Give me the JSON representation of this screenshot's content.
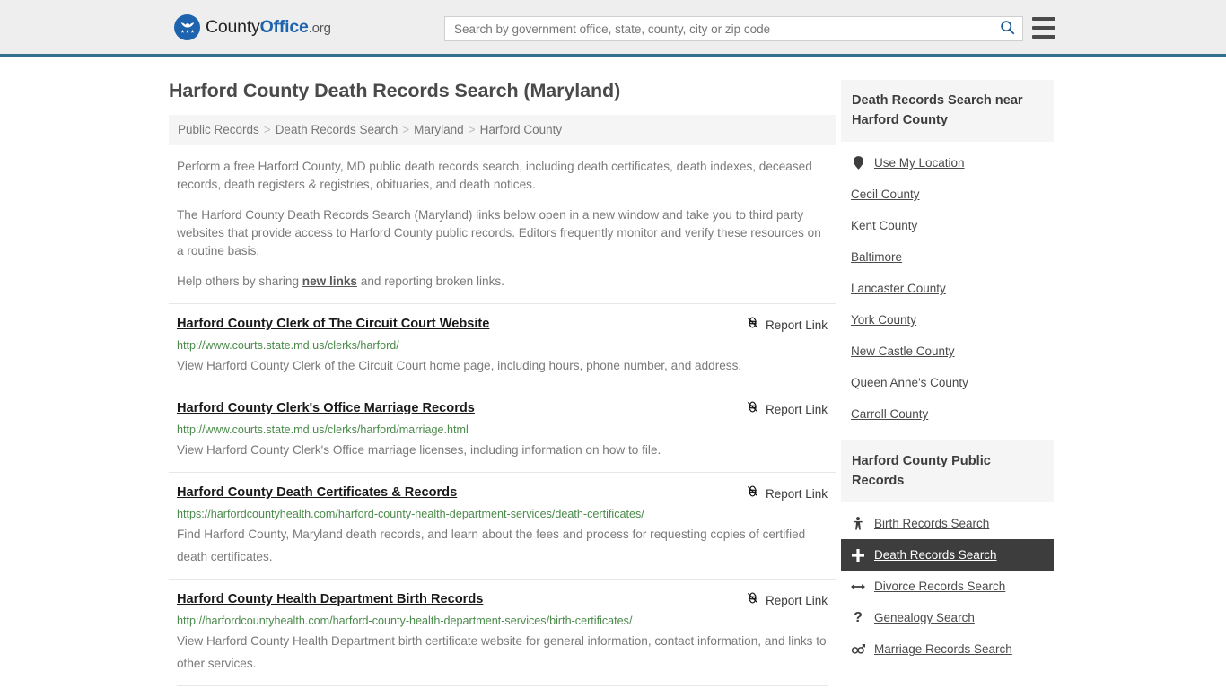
{
  "header": {
    "brand": {
      "part1": "County",
      "part2": "Office",
      "part3": ".org",
      "logo_icon": "eagle-shield-logo"
    },
    "search": {
      "value": "",
      "placeholder": "Search by government office, state, county, city or zip code",
      "icon": "search-icon"
    },
    "menu_icon": "hamburger-menu-icon"
  },
  "page": {
    "title": "Harford County Death Records Search (Maryland)",
    "breadcrumb": [
      "Public Records",
      "Death Records Search",
      "Maryland",
      "Harford County"
    ],
    "breadcrumb_separator": ">",
    "intro": [
      "Perform a free Harford County, MD public death records search, including death certificates, death indexes, deceased records, death registers & registries, obituaries, and death notices.",
      "The Harford County Death Records Search (Maryland) links below open in a new window and take you to third party websites that provide access to Harford County public records. Editors frequently monitor and verify these resources on a routine basis."
    ],
    "help_line": {
      "before": "Help others by sharing ",
      "link": "new links",
      "after": " and reporting broken links."
    }
  },
  "results": {
    "report_label": "Report Link",
    "report_icon": "broken-link-icon",
    "items": [
      {
        "title": "Harford County Clerk of The Circuit Court Website",
        "url": "http://www.courts.state.md.us/clerks/harford/",
        "description": "View Harford County Clerk of the Circuit Court home page, including hours, phone number, and address."
      },
      {
        "title": "Harford County Clerk's Office Marriage Records",
        "url": "http://www.courts.state.md.us/clerks/harford/marriage.html",
        "description": "View Harford County Clerk's Office marriage licenses, including information on how to file."
      },
      {
        "title": "Harford County Death Certificates & Records",
        "url": "https://harfordcountyhealth.com/harford-county-health-department-services/death-certificates/",
        "description": "Find Harford County, Maryland death records, and learn about the fees and process for requesting copies of certified death certificates."
      },
      {
        "title": "Harford County Health Department Birth Records",
        "url": "http://harfordcountyhealth.com/harford-county-health-department-services/birth-certificates/",
        "description": "View Harford County Health Department birth certificate website for general information, contact information, and links to other services."
      }
    ]
  },
  "sidebar": {
    "nearby": {
      "heading": "Death Records Search near Harford County",
      "items": [
        {
          "label": "Use My Location",
          "icon": "map-pin-icon"
        },
        {
          "label": "Cecil County",
          "icon": ""
        },
        {
          "label": "Kent County",
          "icon": ""
        },
        {
          "label": "Baltimore",
          "icon": ""
        },
        {
          "label": "Lancaster County",
          "icon": ""
        },
        {
          "label": "York County",
          "icon": ""
        },
        {
          "label": "New Castle County",
          "icon": ""
        },
        {
          "label": "Queen Anne's County",
          "icon": ""
        },
        {
          "label": "Carroll County",
          "icon": ""
        }
      ]
    },
    "public_records": {
      "heading": "Harford County Public Records",
      "items": [
        {
          "label": "Birth Records Search",
          "icon": "baby-icon",
          "active": false
        },
        {
          "label": "Death Records Search",
          "icon": "plus-icon",
          "active": true
        },
        {
          "label": "Divorce Records Search",
          "icon": "left-right-arrow-icon",
          "active": false
        },
        {
          "label": "Genealogy Search",
          "icon": "question-mark-icon",
          "active": false
        },
        {
          "label": "Marriage Records Search",
          "icon": "male-female-icon",
          "active": false
        }
      ]
    }
  },
  "colors": {
    "brand_blue": "#1e63ad",
    "header_border": "#31708f",
    "header_bg": "#eeeeee",
    "url_green": "#4a8a4a",
    "active_bg": "#3d3d3d"
  }
}
